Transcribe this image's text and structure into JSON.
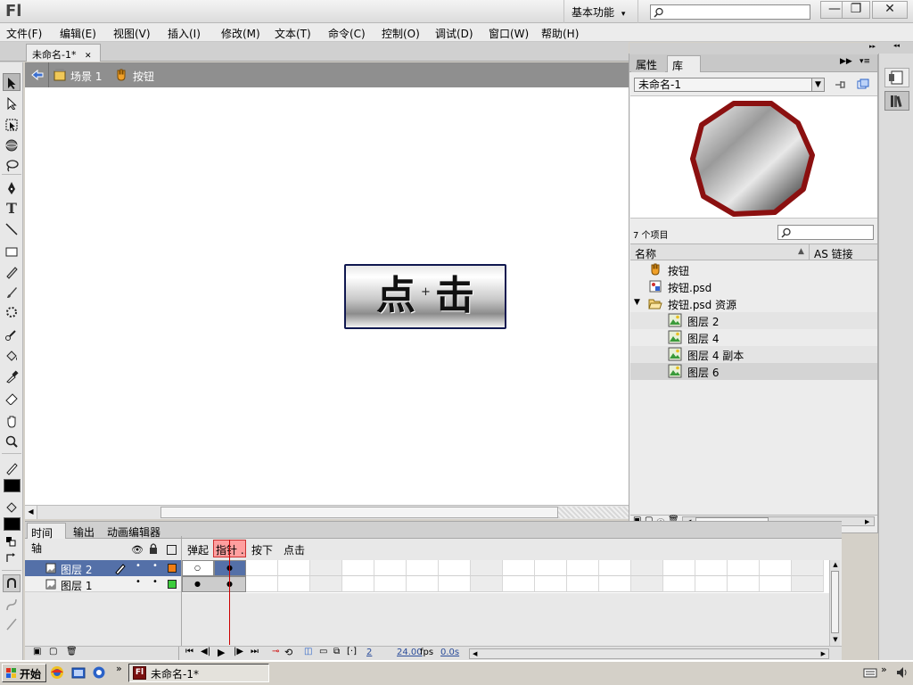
{
  "app": {
    "logo": "Fl",
    "workspace": "基本功能",
    "workspace_caret": "▾"
  },
  "window_buttons": {
    "minimize": "—",
    "restore": "❐",
    "close": "✕"
  },
  "menu": [
    "文件(F)",
    "编辑(E)",
    "视图(V)",
    "插入(I)",
    "修改(M)",
    "文本(T)",
    "命令(C)",
    "控制(O)",
    "调试(D)",
    "窗口(W)",
    "帮助(H)"
  ],
  "document": {
    "tab_title": "未命名-1*",
    "tab_close": "✕"
  },
  "breadcrumb": {
    "scene": "场景 1",
    "symbol": "按钮"
  },
  "stage": {
    "button_text_left": "点",
    "button_text_right": "击",
    "plus": "+"
  },
  "library": {
    "tabs": [
      "属性",
      "库"
    ],
    "document_select": "未命名-1",
    "item_count": "7 个项目",
    "columns": {
      "name": "名称",
      "linkage": "AS 链接"
    },
    "items": [
      {
        "label": "按钮",
        "icon": "button-symbol-icon",
        "indent": 0
      },
      {
        "label": "按钮.psd",
        "icon": "bitmap-icon",
        "indent": 0
      },
      {
        "label": "按钮.psd 资源",
        "icon": "folder-open-icon",
        "indent": 0,
        "expanded": true
      },
      {
        "label": "图层 2",
        "icon": "bitmap-image-icon",
        "indent": 1
      },
      {
        "label": "图层 4",
        "icon": "bitmap-image-icon",
        "indent": 1
      },
      {
        "label": "图层 4 副本",
        "icon": "bitmap-image-icon",
        "indent": 1
      },
      {
        "label": "图层 6",
        "icon": "bitmap-image-icon",
        "indent": 1,
        "selected": true
      }
    ]
  },
  "timeline": {
    "tabs": [
      "时间轴",
      "输出",
      "动画编辑器"
    ],
    "frame_labels": [
      "弹起",
      "指针 ...",
      "按下",
      "点击"
    ],
    "layers": [
      {
        "name": "图层 2",
        "color": "#f07d14",
        "selected": true
      },
      {
        "name": "图层 1",
        "color": "#3ccc3c",
        "selected": false
      }
    ],
    "status": {
      "frame": "2",
      "fps": "24.00",
      "fps_unit": "fps",
      "time": "0.0s"
    }
  },
  "taskbar": {
    "start": "开始",
    "task": "未命名-1*",
    "chevron": "»"
  },
  "colors": {
    "accent_selected": "#5470a8",
    "playhead": "#cc0000",
    "frame_highlight": "#ff9f9f",
    "stage_button_border": "#101850",
    "library_preview_stroke": "#8b1010"
  }
}
